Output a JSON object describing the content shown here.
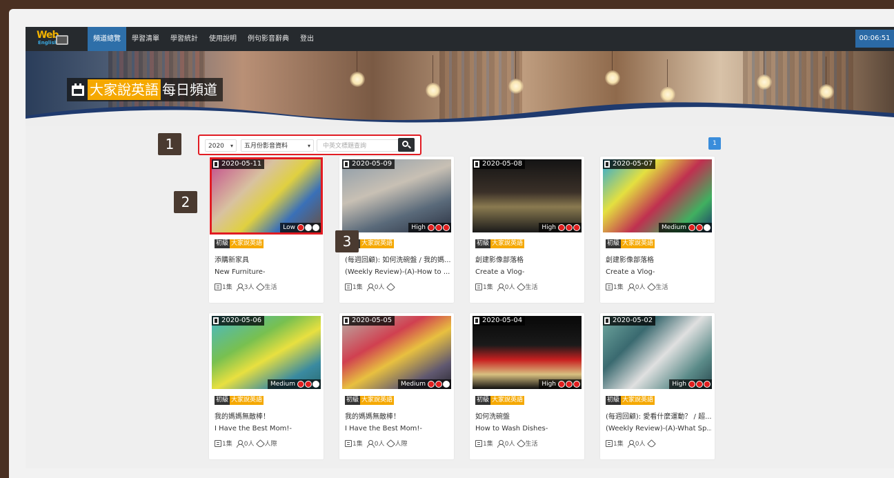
{
  "app": {
    "logo_text_top": "Web",
    "logo_text_bottom": "English"
  },
  "nav": {
    "items": [
      "頻道總覽",
      "學習清單",
      "學習統計",
      "使用說明",
      "例句影音辭典",
      "登出"
    ],
    "active_index": 0
  },
  "timer": "00:06:51",
  "banner": {
    "title_highlight": "大家說英語",
    "title_rest": "每日頻道"
  },
  "filter": {
    "year": "2020",
    "month": "五月份影音資料",
    "search_placeholder": "中英文標題查詢"
  },
  "pagination": {
    "current": "1"
  },
  "callouts": [
    "1",
    "2",
    "3"
  ],
  "cards": [
    {
      "date": "2020-05-11",
      "level": "Low",
      "level_dots": 1,
      "badge_level": "初級",
      "badge_series": "大家說英語",
      "title_cn": "添購新家具",
      "title_en": "New Furniture-",
      "episodes": "1集",
      "users": "3人",
      "tag": "生活",
      "highlighted": true
    },
    {
      "date": "2020-05-09",
      "level": "High",
      "level_dots": 3,
      "badge_level": "初級",
      "badge_series": "大家說英語",
      "title_cn": "(每週回顧): 如何洗碗盤 / 我的媽...",
      "title_en": "(Weekly Review)-(A)-How to ...",
      "episodes": "1集",
      "users": "0人",
      "tag": "",
      "highlighted": false
    },
    {
      "date": "2020-05-08",
      "level": "High",
      "level_dots": 3,
      "badge_level": "初級",
      "badge_series": "大家說英語",
      "title_cn": "創建影像部落格",
      "title_en": "Create a Vlog-",
      "episodes": "1集",
      "users": "0人",
      "tag": "生活",
      "highlighted": false
    },
    {
      "date": "2020-05-07",
      "level": "Medium",
      "level_dots": 2,
      "badge_level": "初級",
      "badge_series": "大家說英語",
      "title_cn": "創建影像部落格",
      "title_en": "Create a Vlog-",
      "episodes": "1集",
      "users": "0人",
      "tag": "生活",
      "highlighted": false
    },
    {
      "date": "2020-05-06",
      "level": "Medium",
      "level_dots": 2,
      "badge_level": "初級",
      "badge_series": "大家說英語",
      "title_cn": "我的媽媽無敵棒！",
      "title_en": "I Have the Best Mom!-",
      "episodes": "1集",
      "users": "0人",
      "tag": "人際",
      "highlighted": false
    },
    {
      "date": "2020-05-05",
      "level": "Medium",
      "level_dots": 2,
      "badge_level": "初級",
      "badge_series": "大家說英語",
      "title_cn": "我的媽媽無敵棒！",
      "title_en": "I Have the Best Mom!-",
      "episodes": "1集",
      "users": "0人",
      "tag": "人際",
      "highlighted": false
    },
    {
      "date": "2020-05-04",
      "level": "High",
      "level_dots": 3,
      "badge_level": "初級",
      "badge_series": "大家說英語",
      "title_cn": "如何洗碗盤",
      "title_en": "How to Wash Dishes-",
      "episodes": "1集",
      "users": "0人",
      "tag": "生活",
      "highlighted": false
    },
    {
      "date": "2020-05-02",
      "level": "High",
      "level_dots": 3,
      "badge_level": "初級",
      "badge_series": "大家說英語",
      "title_cn": "(每週回顧): 愛看什麼運動？ / 超...",
      "title_en": "(Weekly Review)-(A)-What Sp...",
      "episodes": "1集",
      "users": "0人",
      "tag": "",
      "highlighted": false
    }
  ],
  "colors": {
    "accent": "#f5a800",
    "nav_active": "#2e6fa9",
    "highlight_red": "#e11b22",
    "frame_brown": "#4a3022"
  }
}
